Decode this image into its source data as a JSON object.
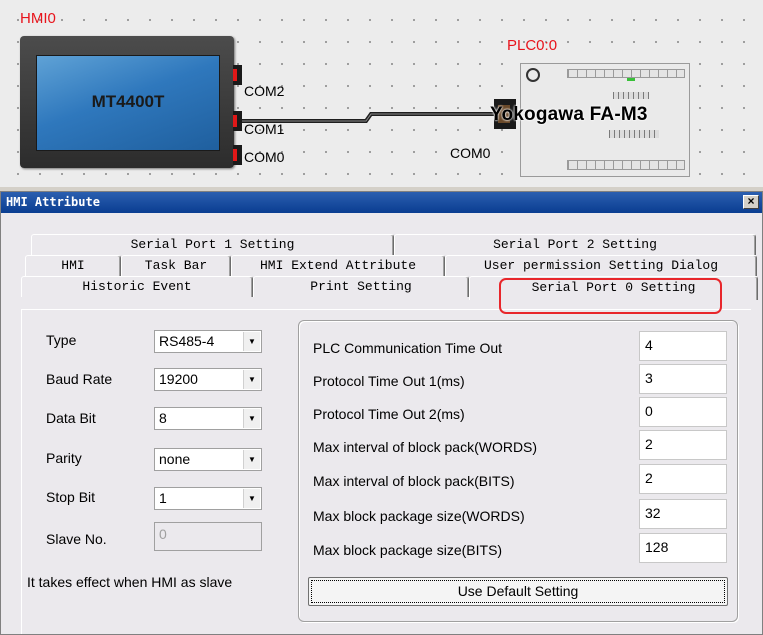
{
  "canvas": {
    "hmi_label": "HMI0",
    "hmi_model": "MT4400T",
    "hmi_ports": [
      "COM2",
      "COM1",
      "COM0"
    ],
    "plc_label": "PLC0:0",
    "plc_model": "Yokogawa FA-M3",
    "plc_port": "COM0",
    "colors": {
      "label_red": "#e8141c",
      "hmi_screen_blue": "#2f78bd"
    }
  },
  "dialog": {
    "title": "HMI Attribute",
    "close_label": "×",
    "tabs_row1": [
      "Serial Port 1 Setting",
      "Serial Port 2 Setting"
    ],
    "tabs_row2": [
      "HMI",
      "Task Bar",
      "HMI Extend Attribute",
      "User permission Setting Dialog"
    ],
    "tabs_row3": [
      "Historic Event",
      "Print Setting",
      "Serial Port 0 Setting"
    ],
    "active_tab": "Serial Port 0 Setting",
    "fields": {
      "type": {
        "label": "Type",
        "value": "RS485-4"
      },
      "baud_rate": {
        "label": "Baud Rate",
        "value": "19200"
      },
      "data_bit": {
        "label": "Data Bit",
        "value": "8"
      },
      "parity": {
        "label": "Parity",
        "value": "none"
      },
      "stop_bit": {
        "label": "Stop Bit",
        "value": "1"
      },
      "slave_no": {
        "label": "Slave No.",
        "value": "0"
      }
    },
    "note": "It takes effect when HMI as slave",
    "params": [
      {
        "label": "PLC Communication Time Out",
        "value": "4"
      },
      {
        "label": "Protocol Time Out 1(ms)",
        "value": "3"
      },
      {
        "label": "Protocol Time Out 2(ms)",
        "value": "0"
      },
      {
        "label": "Max interval of block pack(WORDS)",
        "value": "2"
      },
      {
        "label": "Max interval of block pack(BITS)",
        "value": "2"
      },
      {
        "label": "Max block package size(WORDS)",
        "value": "32"
      },
      {
        "label": "Max block package size(BITS)",
        "value": "128"
      }
    ],
    "default_button": "Use Default Setting"
  }
}
